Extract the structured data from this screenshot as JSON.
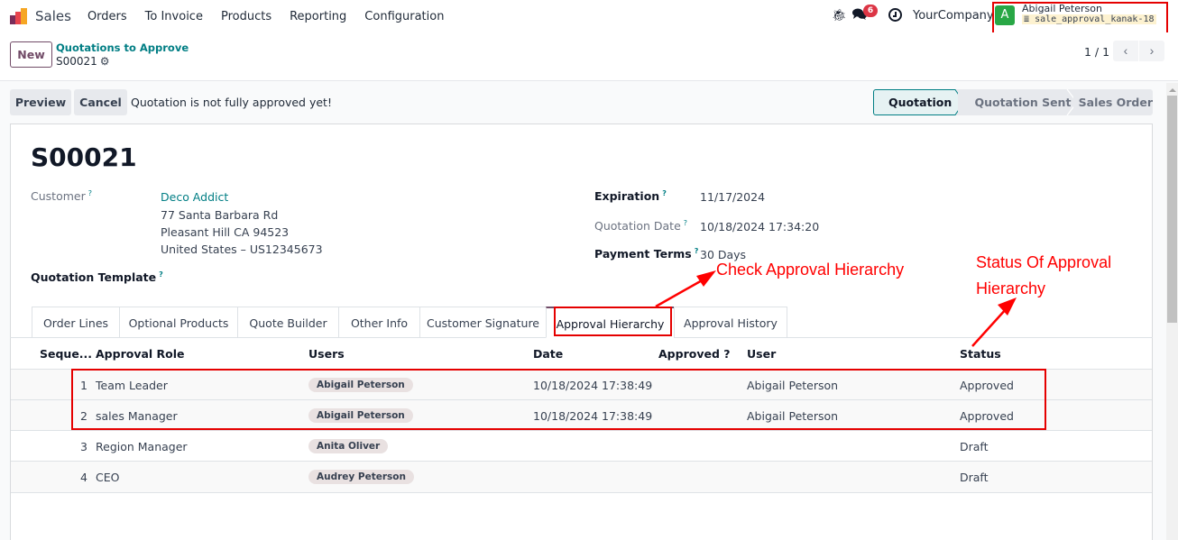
{
  "navbar": {
    "app_name": "Sales",
    "menu": [
      "Orders",
      "To Invoice",
      "Products",
      "Reporting",
      "Configuration"
    ],
    "icons": [
      "debug-bug-icon",
      "chat-icon",
      "activity-clock-icon"
    ],
    "messages_badge": "6",
    "company": "YourCompany",
    "user": {
      "avatar_letter": "A",
      "name": "Abigail Peterson",
      "database": "sale_approval_kanak-18",
      "avatar_color": "#28a745"
    }
  },
  "control_panel": {
    "new_label": "New",
    "breadcrumb": "Quotations to Approve",
    "record": "S00021",
    "pager": "1 / 1",
    "prev_symbol": "‹",
    "next_symbol": "›"
  },
  "actions": {
    "preview_label": "Preview",
    "cancel_label": "Cancel",
    "message": "Quotation is not fully approved yet!"
  },
  "statusbar": {
    "stages": [
      "Quotation",
      "Quotation Sent",
      "Sales Order"
    ],
    "active": "Quotation"
  },
  "form": {
    "title": "S00021",
    "customer_label": "Customer",
    "customer_name": "Deco Addict",
    "customer_address": [
      "77 Santa Barbara Rd",
      "Pleasant Hill CA 94523",
      "United States – US12345673"
    ],
    "quotation_template_label": "Quotation Template",
    "expiration_label": "Expiration",
    "expiration": "11/17/2024",
    "quotation_date_label": "Quotation Date",
    "quotation_date": "10/18/2024 17:34:20",
    "payment_terms_label": "Payment Terms",
    "payment_terms": "30 Days",
    "help_mark": "?"
  },
  "tabs": [
    "Order Lines",
    "Optional Products",
    "Quote Builder",
    "Other Info",
    "Customer Signature",
    "Approval Hierarchy",
    "Approval History"
  ],
  "active_tab": "Approval Hierarchy",
  "table": {
    "columns": [
      "Seque...",
      "Approval Role",
      "Users",
      "Date",
      "Approved ?",
      "User",
      "Status"
    ],
    "rows": [
      {
        "seq": "1",
        "role": "Team Leader",
        "users": "Abigail Peterson",
        "date": "10/18/2024 17:38:49",
        "approved": "",
        "user": "Abigail Peterson",
        "status": "Approved"
      },
      {
        "seq": "2",
        "role": "sales Manager",
        "users": "Abigail Peterson",
        "date": "10/18/2024 17:38:49",
        "approved": "",
        "user": "Abigail Peterson",
        "status": "Approved"
      },
      {
        "seq": "3",
        "role": "Region Manager",
        "users": "Anita Oliver",
        "date": "",
        "approved": "",
        "user": "",
        "status": "Draft"
      },
      {
        "seq": "4",
        "role": "CEO",
        "users": "Audrey Peterson",
        "date": "",
        "approved": "",
        "user": "",
        "status": "Draft"
      }
    ]
  },
  "annotations": {
    "check_label": "Check Approval Hierarchy",
    "status_label_line1": "Status Of Approval",
    "status_label_line2": "Hierarchy",
    "color": "#ff0000"
  },
  "colors": {
    "brand": "#714b67",
    "link": "#017e84",
    "badge": "#dc3545"
  }
}
